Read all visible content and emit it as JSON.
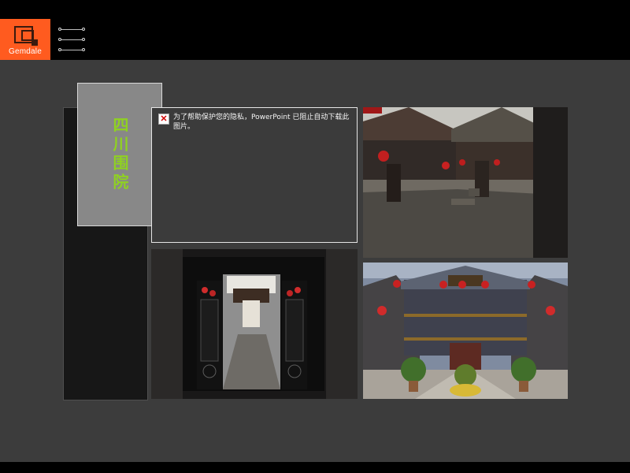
{
  "logo": {
    "text": "Gemdale"
  },
  "slide": {
    "title": "四川围院",
    "image_placeholder_text": "为了帮助保护您的隐私，PowerPoint 已阻止自动下载此图片。"
  },
  "colors": {
    "logo_orange": "#ff5b1f",
    "background": "#3c3c3c",
    "header_black": "#000000",
    "title_green": "#8fd122",
    "title_card_gray": "#888888"
  },
  "icons": {
    "menu": "menu-icon",
    "broken_image": "broken-image-icon"
  }
}
